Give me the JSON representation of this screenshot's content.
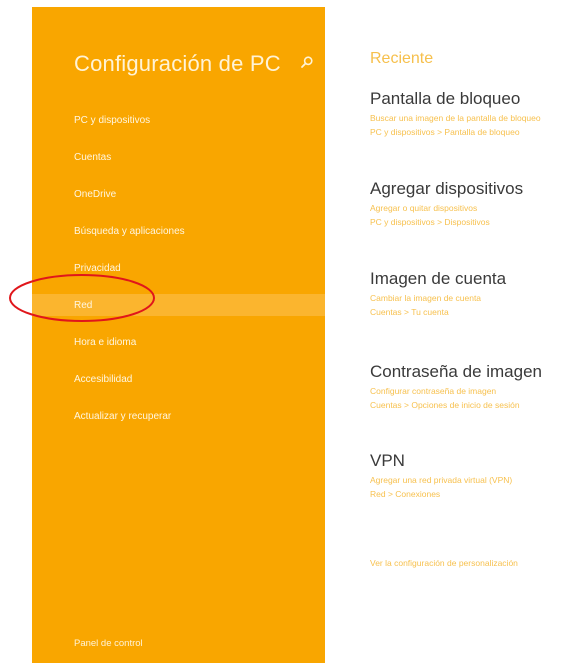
{
  "sidebar": {
    "title": "Configuración de PC",
    "search_icon": "search-icon",
    "items": [
      {
        "label": "PC y dispositivos"
      },
      {
        "label": "Cuentas"
      },
      {
        "label": "OneDrive"
      },
      {
        "label": "Búsqueda y aplicaciones"
      },
      {
        "label": "Privacidad"
      },
      {
        "label": "Red",
        "selected": true
      },
      {
        "label": "Hora e idioma"
      },
      {
        "label": "Accesibilidad"
      },
      {
        "label": "Actualizar y recuperar"
      }
    ],
    "footer": "Panel de control",
    "color": "#f9a600"
  },
  "main": {
    "section_title": "Reciente",
    "entries": [
      {
        "title": "Pantalla de bloqueo",
        "link1": "Buscar una imagen de la pantalla de bloqueo",
        "link2": "PC y dispositivos > Pantalla de bloqueo"
      },
      {
        "title": "Agregar dispositivos",
        "link1": "Agregar o quitar dispositivos",
        "link2": "PC y dispositivos > Dispositivos"
      },
      {
        "title": "Imagen de cuenta",
        "link1": "Cambiar la imagen de cuenta",
        "link2": "Cuentas > Tu cuenta"
      },
      {
        "title": "Contraseña de imagen",
        "link1": "Configurar contraseña de imagen",
        "link2": "Cuentas > Opciones de inicio de sesión"
      },
      {
        "title": "VPN",
        "link1": "Agregar una red privada virtual (VPN)",
        "link2": "Red > Conexiones"
      }
    ],
    "personalize_link": "Ver la configuración de personalización"
  },
  "annotation": {
    "shape": "ellipse",
    "color": "#e0161b",
    "target": "Red"
  }
}
